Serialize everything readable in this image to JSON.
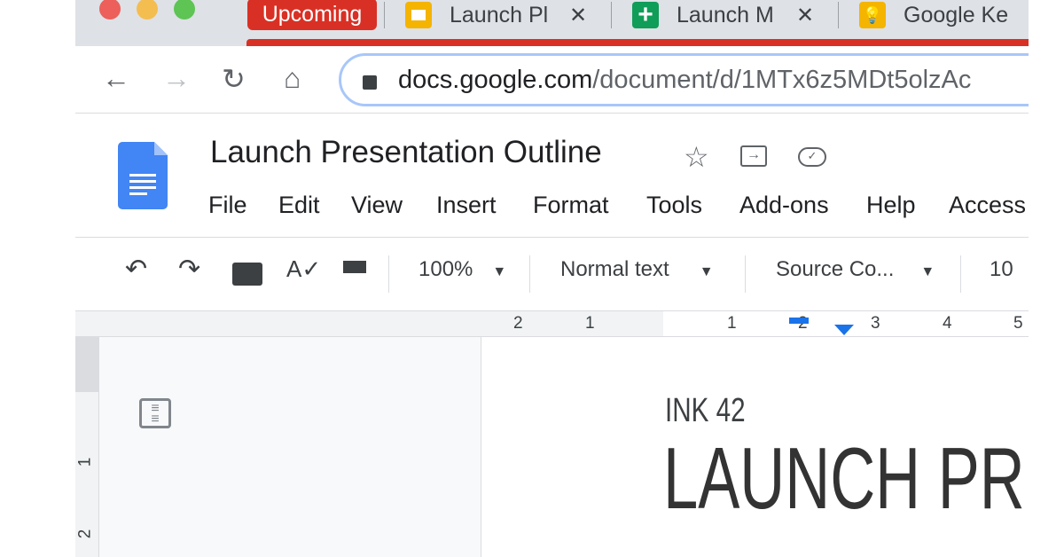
{
  "tabs": [
    {
      "label": "Upcoming",
      "color": "#d93025"
    },
    {
      "label": "Launch Pl",
      "icon": "slides-icon",
      "color": "#f4b400"
    },
    {
      "label": "Launch M",
      "icon": "sheets-icon",
      "color": "#0f9d58"
    },
    {
      "label": "Google Ke",
      "icon": "keep-icon",
      "color": "#f4b400"
    }
  ],
  "address": {
    "host": "docs.google.com",
    "path": "/document/d/1MTx6z5MDt5olzAc"
  },
  "doc": {
    "title": "Launch Presentation Outline"
  },
  "menu": [
    "File",
    "Edit",
    "View",
    "Insert",
    "Format",
    "Tools",
    "Add-ons",
    "Help",
    "Access"
  ],
  "toolbar": {
    "zoom": "100%",
    "style": "Normal text",
    "font": "Source Co...",
    "size": "10"
  },
  "ruler": {
    "h": [
      "2",
      "1",
      "1",
      "2",
      "3",
      "4",
      "5"
    ],
    "v": [
      "1",
      "2"
    ]
  },
  "page": {
    "kicker": "INK 42",
    "heading": "LAUNCH PR"
  },
  "colors": {
    "accent": "#1a73e8",
    "tabbar": "#dee1e6"
  }
}
